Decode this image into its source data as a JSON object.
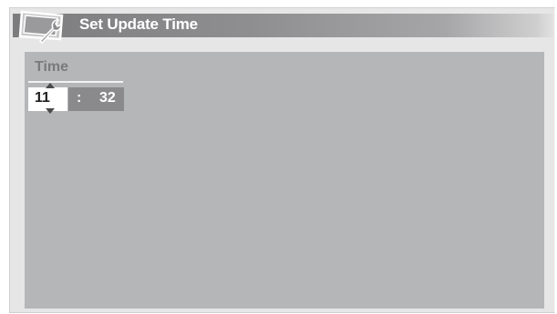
{
  "dialog": {
    "title": "Set Update Time",
    "icon": "tv-wrench-icon"
  },
  "time_setting": {
    "label": "Time",
    "hour": "11",
    "separator": ":",
    "minute": "32"
  },
  "colors": {
    "title_bar": "#8f8f91",
    "panel": "#b5b6b8",
    "selected_field": "#ffffff",
    "field_group": "#8a8a8c"
  }
}
